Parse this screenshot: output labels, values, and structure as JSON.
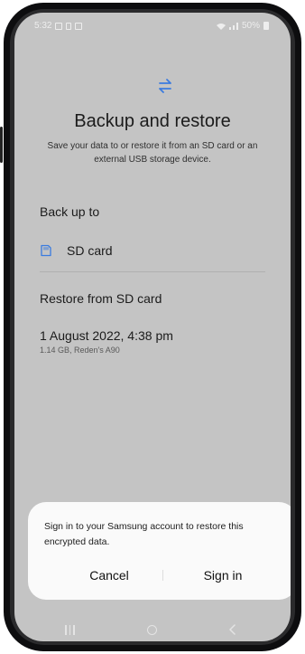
{
  "statusbar": {
    "time": "5:32",
    "battery": "50%"
  },
  "page": {
    "title": "Backup and restore",
    "subtitle": "Save your data to or restore it from an SD card or an external USB storage device."
  },
  "backup_section": {
    "heading": "Back up to",
    "items": [
      {
        "label": "SD card",
        "icon": "sd-card-icon"
      }
    ]
  },
  "restore_section": {
    "heading": "Restore from SD card",
    "backup": {
      "date": "1 August 2022, 4:38 pm",
      "details": "1.14 GB, Reden's A90"
    }
  },
  "dialog": {
    "message": "Sign in to your Samsung account to restore this encrypted data.",
    "cancel_label": "Cancel",
    "signin_label": "Sign in"
  },
  "navbar": {
    "icons": [
      "recents-icon",
      "home-icon",
      "back-icon"
    ]
  },
  "colors": {
    "accent": "#3a7be0",
    "dim_background": "#c4c4c4",
    "dialog_background": "#fafafa"
  }
}
